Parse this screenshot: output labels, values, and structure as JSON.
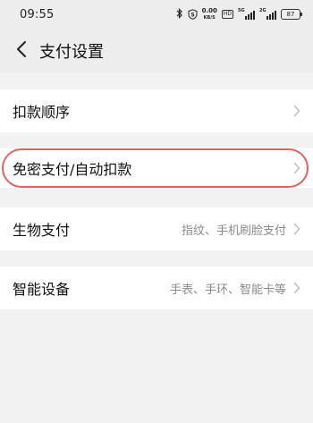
{
  "status_bar": {
    "time": "09:55",
    "icons": [
      "bluetooth-icon",
      "shield-icon",
      "network-speed-icon",
      "hd-icon",
      "signal-5g-icon",
      "signal-2g-icon",
      "battery-icon"
    ],
    "network_speed_value": "0.00",
    "network_speed_unit": "KB/S",
    "hd_label": "HD",
    "signal_1_label": "5G",
    "signal_2_label": "2G",
    "battery_level": "87"
  },
  "header": {
    "title": "支付设置",
    "back_icon": "chevron-left-icon"
  },
  "settings": {
    "items": [
      {
        "label": "扣款顺序",
        "value": ""
      },
      {
        "label": "免密支付/自动扣款",
        "value": ""
      },
      {
        "label": "生物支付",
        "value": "指纹、手机刷脸支付"
      },
      {
        "label": "智能设备",
        "value": "手表、手环、智能卡等"
      }
    ]
  },
  "annotation": {
    "highlight_color": "#e56060"
  },
  "colors": {
    "background": "#f2f2f2",
    "header_background": "#ededed",
    "card_background": "#ffffff",
    "secondary_text": "#8a8a8a"
  }
}
